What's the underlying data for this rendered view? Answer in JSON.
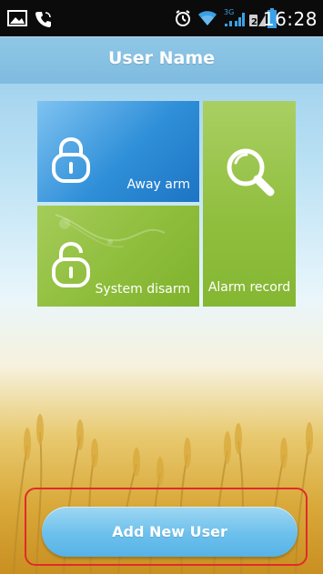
{
  "status_bar": {
    "time": "16:28",
    "icons": [
      "image-icon",
      "phone-icon",
      "alarm-clock-icon",
      "wifi-icon",
      "signal-3g-icon",
      "signal-2-icon",
      "battery-icon"
    ],
    "signal_label_1": "3G",
    "signal_label_2": "2"
  },
  "header": {
    "title": "User Name"
  },
  "tiles": {
    "away_arm": {
      "label": "Away arm",
      "icon": "padlock-locked-icon",
      "color": "#2f8fd8"
    },
    "system_disarm": {
      "label": "System disarm",
      "icon": "padlock-unlocked-icon",
      "color": "#8ebd3b"
    },
    "alarm_record": {
      "label": "Alarm record",
      "icon": "magnifier-icon",
      "color": "#8fbe3d"
    }
  },
  "footer": {
    "add_user_label": "Add New User",
    "highlight_color": "#e02b2b"
  },
  "colors": {
    "accent_blue": "#56b3e6",
    "title_bar": "#8fc7e6"
  }
}
